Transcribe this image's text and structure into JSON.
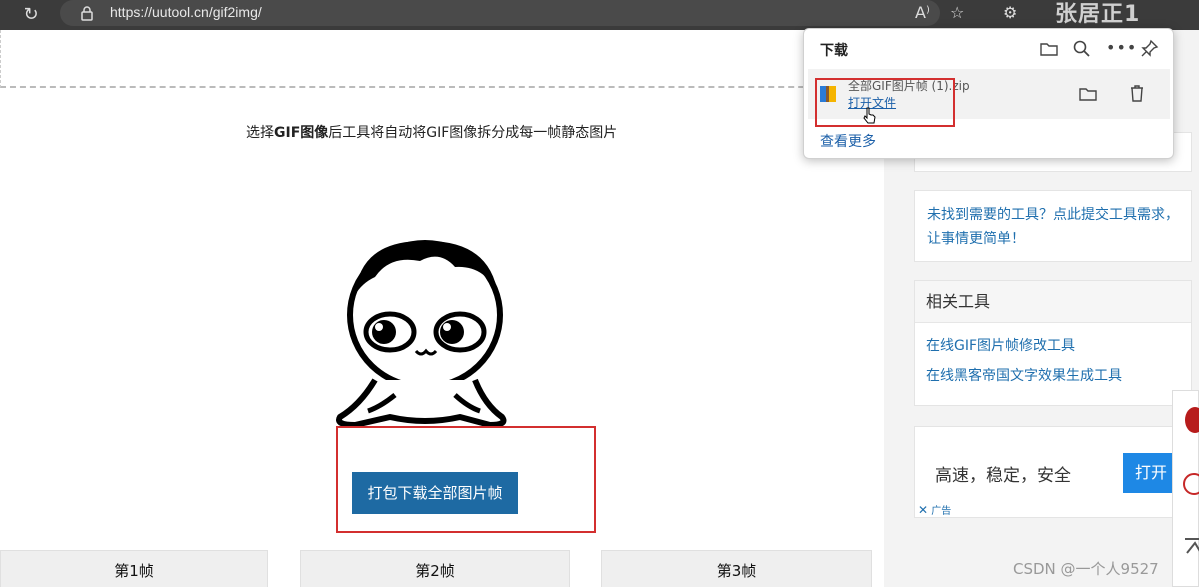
{
  "browser": {
    "url": "https://uutool.cn/gif2img/",
    "watermark": "张居正1"
  },
  "page": {
    "hint_prefix": "选择",
    "hint_bold": "GIF图像",
    "hint_suffix": "后工具将自动将GIF图像拆分成每一帧静态图片",
    "download_all_button": "打包下载全部图片帧",
    "frames": [
      "第1帧",
      "第2帧",
      "第3帧"
    ]
  },
  "sidebar": {
    "request_link": "未找到需要的工具？点此提交工具需求，让事情更简单！",
    "related_title": "相关工具",
    "related_links": [
      "在线GIF图片帧修改工具",
      "在线黑客帝国文字效果生成工具"
    ],
    "ad_text": "高速，稳定，安全",
    "ad_button": "打开",
    "ad_label": "广告"
  },
  "downloads": {
    "title": "下载",
    "file_name": "全部GIF图片帧 (1).zip",
    "open_file": "打开文件",
    "see_more": "查看更多"
  },
  "footer": {
    "watermark": "CSDN @一个人9527"
  },
  "colors": {
    "button_blue": "#1e6aa3",
    "link_blue": "#1f6fae",
    "highlight_red": "#d32f2f",
    "ad_button_blue": "#1e88e5"
  }
}
